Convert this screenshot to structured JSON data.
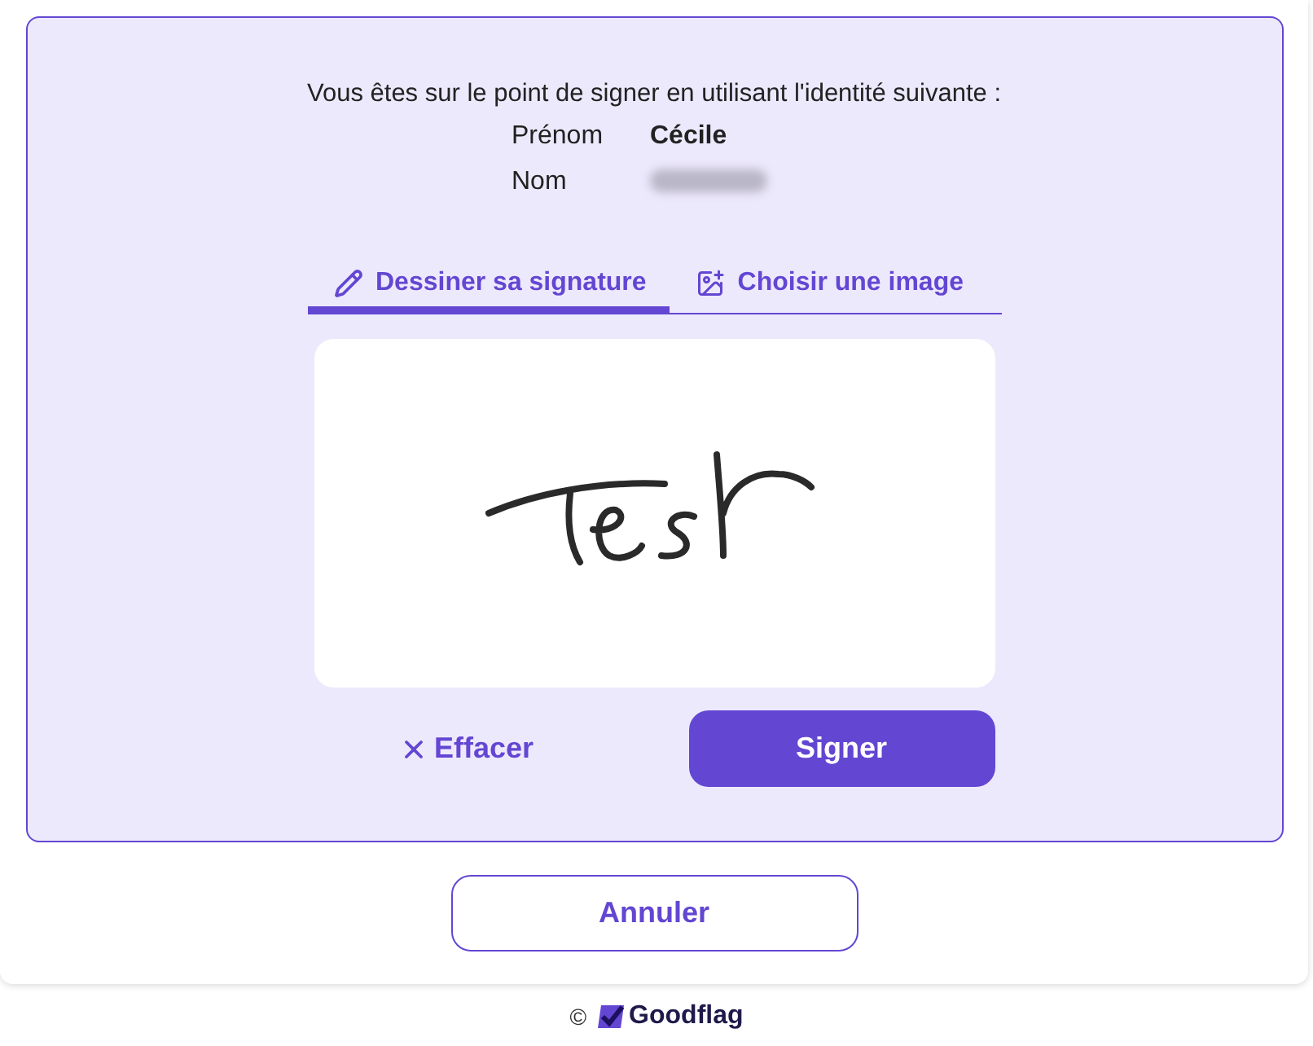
{
  "intro": "Vous êtes sur le point de signer en utilisant l'identité suivante :",
  "identity": [
    {
      "kind": "text",
      "label": "Prénom",
      "value": "Cécile"
    },
    {
      "kind": "blurred",
      "label": "Nom"
    }
  ],
  "tabs": [
    {
      "label": "Dessiner sa signature",
      "selected": true
    },
    {
      "label": "Choisir une image",
      "selected": false
    }
  ],
  "actions": {
    "clear": "Effacer",
    "sign": "Signer"
  },
  "cancel": "Annuler",
  "footer": {
    "copyright": "©",
    "brand": "Goodflag"
  }
}
